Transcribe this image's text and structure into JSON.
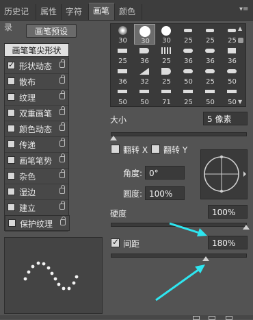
{
  "tabs": [
    {
      "label": "历史记录",
      "active": false
    },
    {
      "label": "属性",
      "active": false
    },
    {
      "label": "字符",
      "active": false
    },
    {
      "label": "画笔",
      "active": true
    },
    {
      "label": "颜色",
      "active": false
    }
  ],
  "left": {
    "preset_button": "画笔预设",
    "tip_shape": "画笔笔尖形状",
    "options": [
      {
        "label": "形状动态",
        "checked": true
      },
      {
        "label": "散布",
        "checked": false
      },
      {
        "label": "纹理",
        "checked": false
      },
      {
        "label": "双重画笔",
        "checked": false
      },
      {
        "label": "颜色动态",
        "checked": false
      },
      {
        "label": "传递",
        "checked": false
      },
      {
        "label": "画笔笔势",
        "checked": false
      },
      {
        "label": "杂色",
        "checked": false
      },
      {
        "label": "湿边",
        "checked": false
      },
      {
        "label": "建立",
        "checked": false
      },
      {
        "label": "平滑",
        "checked": true
      },
      {
        "label": "保护纹理",
        "checked": false
      }
    ]
  },
  "brushes": {
    "row1": [
      "30",
      "30",
      "30",
      "25",
      "25",
      "25"
    ],
    "row2": [
      "25",
      "36",
      "25",
      "36",
      "36",
      "36"
    ],
    "row3": [
      "36",
      "32",
      "25",
      "50",
      "25",
      "50"
    ],
    "row4": [
      "50",
      "50",
      "71",
      "25",
      "50",
      "50"
    ]
  },
  "controls": {
    "size_label": "大小",
    "size_value": "5 像素",
    "flip_x": "翻转 X",
    "flip_y": "翻转 Y",
    "angle_label": "角度:",
    "angle_value": "0°",
    "roundness_label": "圆度:",
    "roundness_value": "100%",
    "hardness_label": "硬度",
    "hardness_value": "100%",
    "spacing_label": "间距",
    "spacing_value": "180%",
    "spacing_checked": true
  },
  "colors": {
    "panel": "#535353",
    "tabbar": "#3d3d3d",
    "arrow": "#2ee6f0"
  }
}
